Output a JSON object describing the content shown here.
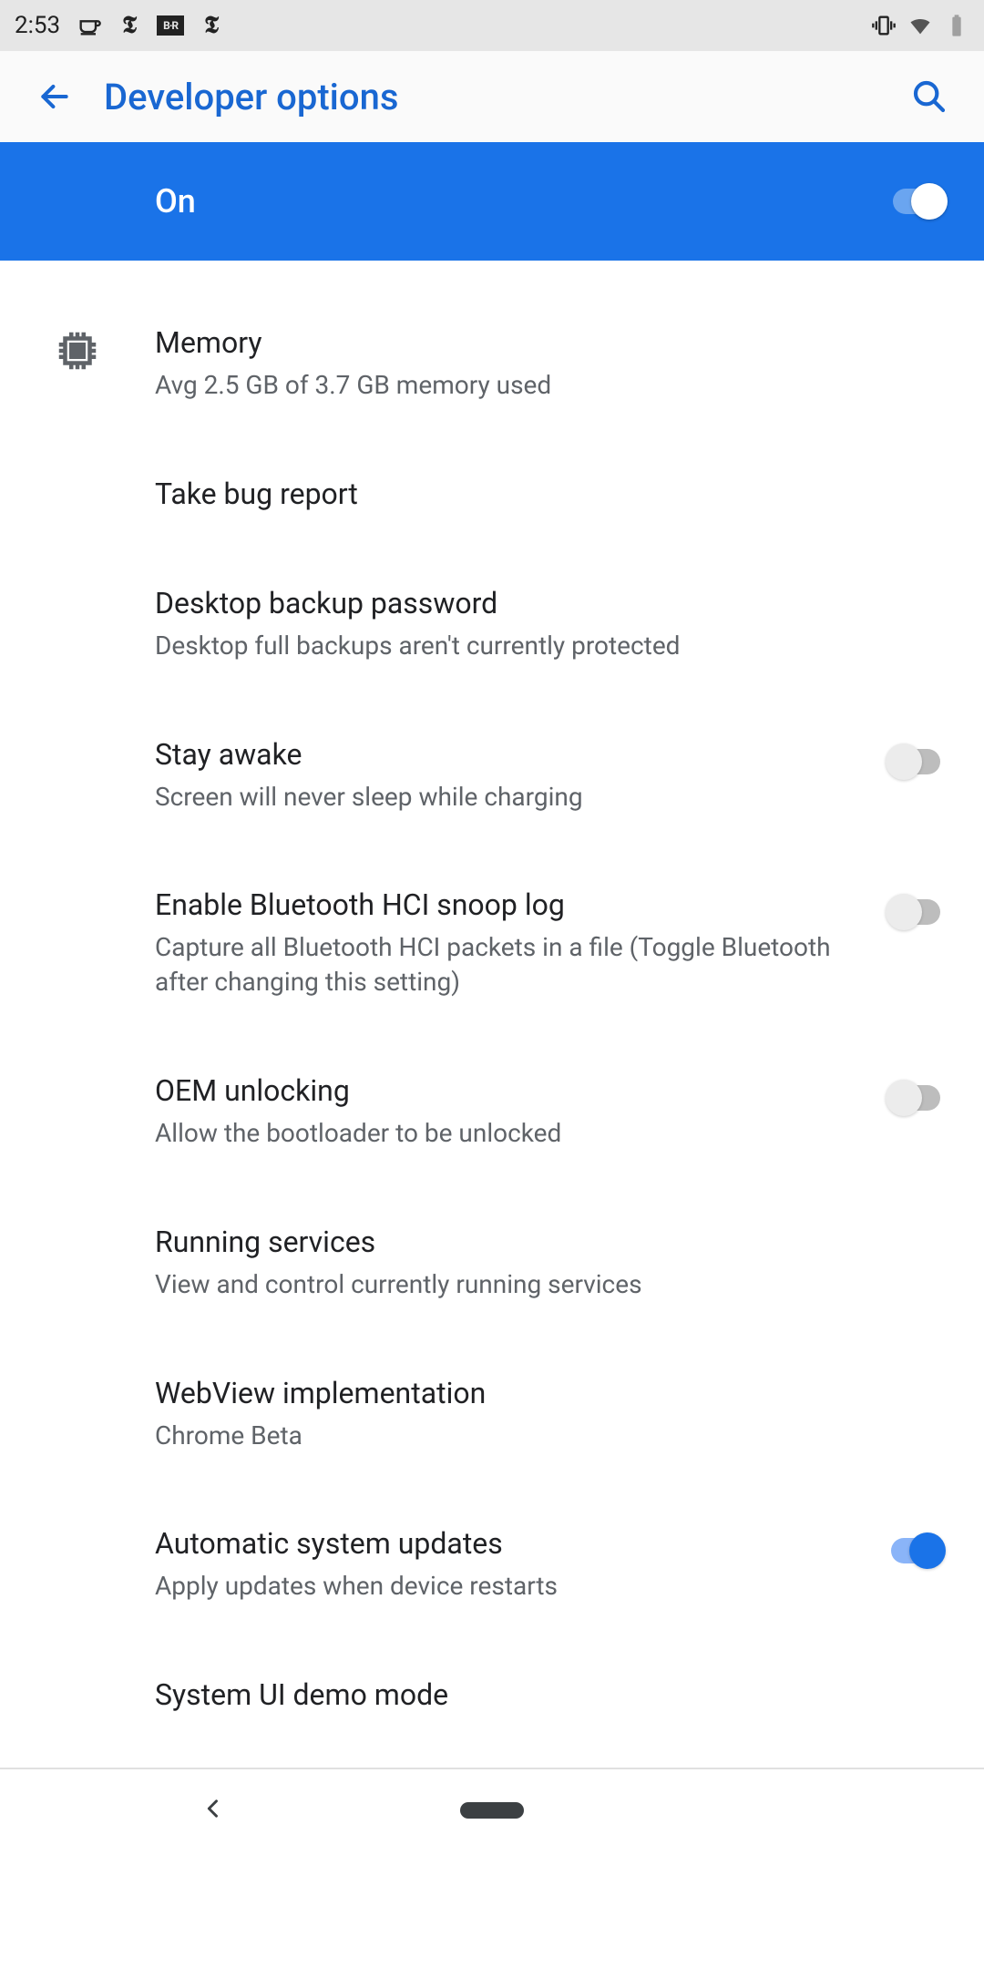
{
  "statusbar": {
    "time": "2:53",
    "app_labels": [
      "☕",
      "𝕿",
      "B·R",
      "𝕿"
    ]
  },
  "header": {
    "title": "Developer options"
  },
  "master": {
    "label": "On",
    "enabled": true
  },
  "items": [
    {
      "key": "memory",
      "title": "Memory",
      "sub": "Avg 2.5 GB of 3.7 GB memory used",
      "icon": "chip",
      "toggle": null
    },
    {
      "key": "bugreport",
      "title": "Take bug report",
      "sub": "",
      "icon": "",
      "toggle": null
    },
    {
      "key": "backup",
      "title": "Desktop backup password",
      "sub": "Desktop full backups aren't currently protected",
      "icon": "",
      "toggle": null
    },
    {
      "key": "stayawake",
      "title": "Stay awake",
      "sub": "Screen will never sleep while charging",
      "icon": "",
      "toggle": false
    },
    {
      "key": "bthci",
      "title": "Enable Bluetooth HCI snoop log",
      "sub": "Capture all Bluetooth HCI packets in a file (Toggle Bluetooth after changing this setting)",
      "icon": "",
      "toggle": false
    },
    {
      "key": "oem",
      "title": "OEM unlocking",
      "sub": "Allow the bootloader to be unlocked",
      "icon": "",
      "toggle": false
    },
    {
      "key": "running",
      "title": "Running services",
      "sub": "View and control currently running services",
      "icon": "",
      "toggle": null
    },
    {
      "key": "webview",
      "title": "WebView implementation",
      "sub": "Chrome Beta",
      "icon": "",
      "toggle": null
    },
    {
      "key": "autoupdate",
      "title": "Automatic system updates",
      "sub": "Apply updates when device restarts",
      "icon": "",
      "toggle": true
    },
    {
      "key": "sysui",
      "title": "System UI demo mode",
      "sub": "",
      "icon": "",
      "toggle": null
    }
  ]
}
